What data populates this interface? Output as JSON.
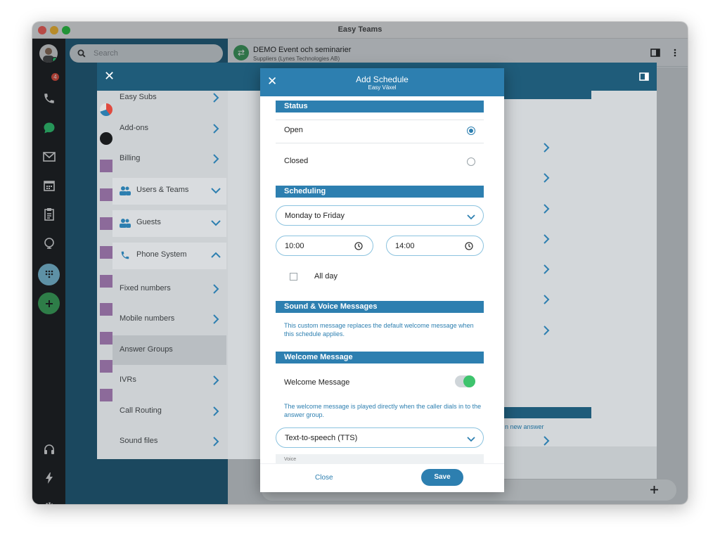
{
  "window": {
    "title": "Easy Teams"
  },
  "rail": {
    "call_badge": "4"
  },
  "search": {
    "placeholder": "Search"
  },
  "chat_header": {
    "title": "DEMO Event och seminarier",
    "subtitle": "Suppliers (Lynes Technologies AB)"
  },
  "settings": {
    "items": [
      {
        "label": "Easy Subs"
      },
      {
        "label": "Add-ons"
      },
      {
        "label": "Billing"
      },
      {
        "label": "Users & Teams"
      },
      {
        "label": "Guests"
      },
      {
        "label": "Phone System"
      },
      {
        "label": "Fixed numbers"
      },
      {
        "label": "Mobile numbers"
      },
      {
        "label": "Answer Groups"
      },
      {
        "label": "IVRs"
      },
      {
        "label": "Call Routing"
      },
      {
        "label": "Sound files"
      }
    ],
    "new_answer_fragment": "n new answer"
  },
  "modal": {
    "title": "Add Schedule",
    "subtitle": "Easy Växel",
    "status_heading": "Status",
    "status_open": "Open",
    "status_closed": "Closed",
    "scheduling_heading": "Scheduling",
    "days_value": "Monday to Friday",
    "start_time": "10:00",
    "end_time": "14:00",
    "all_day": "All day",
    "sound_heading": "Sound & Voice Messages",
    "sound_info": "This custom message replaces the default welcome message when this schedule applies.",
    "welcome_heading": "Welcome Message",
    "welcome_label": "Welcome Message",
    "welcome_info": "The welcome message is played directly when the caller dials in to the answer group.",
    "tts_value": "Text-to-speech (TTS)",
    "voice_label": "Voice",
    "close_label": "Close",
    "save_label": "Save"
  },
  "colors": {
    "accent": "#2d7fb0",
    "sidebar": "#1f5c7a",
    "toggle_on": "#3ec46d"
  }
}
